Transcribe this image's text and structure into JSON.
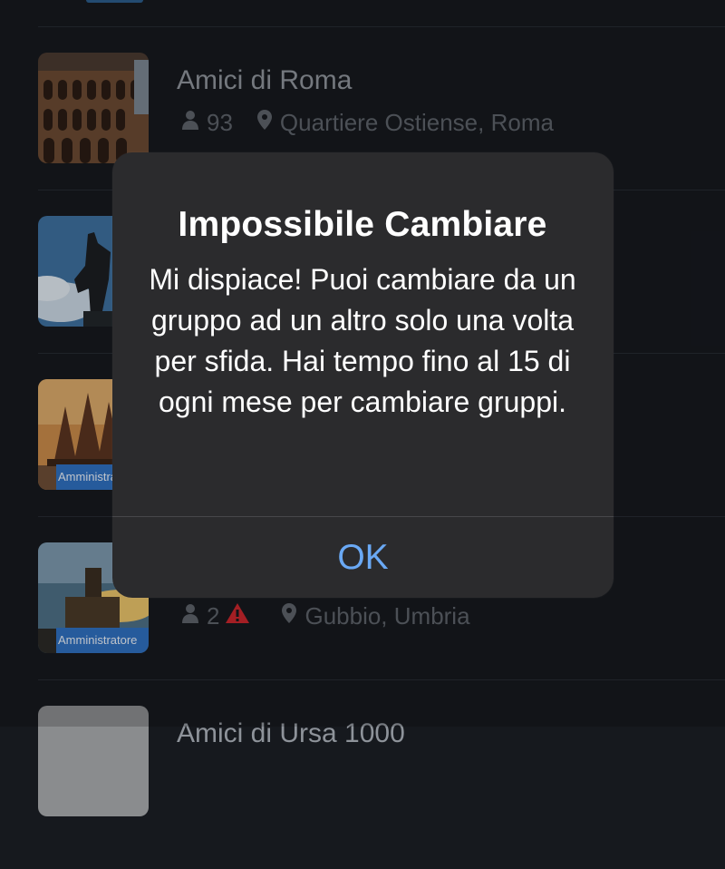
{
  "groups": [
    {
      "name": "Amici di Roma",
      "members": "93",
      "location": "Quartiere Ostiense, Roma"
    },
    {
      "admin_badge": "Amministratore"
    },
    {
      "admin_badge": "Amministratore",
      "members": "2",
      "location": "Gubbio, Umbria"
    },
    {
      "name": "Amici di Ursa 1000"
    }
  ],
  "alert": {
    "title": "Impossibile Cambiare",
    "message": "Mi dispiace! Puoi cambiare da un gruppo ad un altro solo una volta per sfida. Hai tempo fino al 15 di ogni mese per cambiare gruppi.",
    "ok_label": "OK"
  },
  "colors": {
    "background": "#16191e",
    "alert_bg": "#2b2b2d",
    "accent": "#6aa9f5",
    "badge": "#2f6fbf",
    "warning": "#d3222a"
  },
  "icons": [
    "person-icon",
    "location-pin-icon",
    "warning-icon"
  ]
}
